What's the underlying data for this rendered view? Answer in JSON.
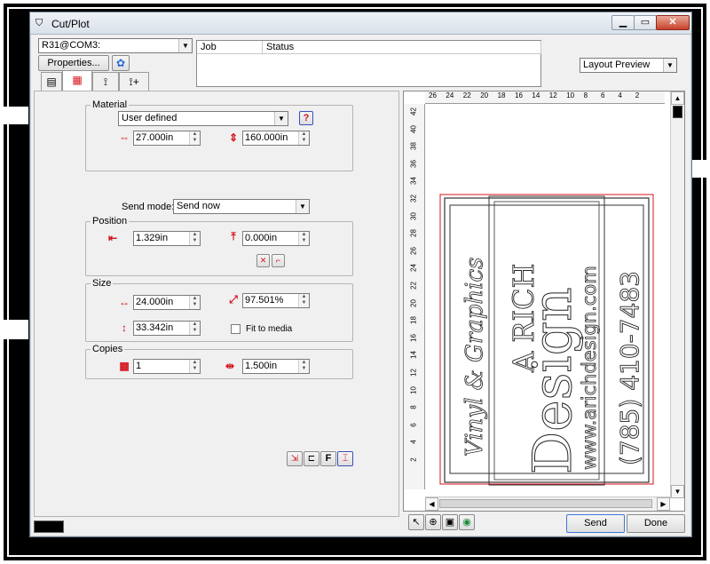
{
  "window": {
    "title": "Cut/Plot"
  },
  "device": {
    "selected": "R31@COM3:"
  },
  "toolbar": {
    "properties_label": "Properties..."
  },
  "job_table": {
    "columns": [
      "Job",
      "Status"
    ]
  },
  "preview_mode": {
    "selected": "Layout Preview"
  },
  "material": {
    "group_label": "Material",
    "type": "User defined",
    "width": "27.000in",
    "height": "160.000in"
  },
  "send_mode": {
    "label": "Send mode:",
    "value": "Send now"
  },
  "position": {
    "group_label": "Position",
    "x": "1.329in",
    "y": "0.000in"
  },
  "size": {
    "group_label": "Size",
    "width": "24.000in",
    "height": "33.342in",
    "scale": "97.501%",
    "fit_to_media_label": "Fit to media",
    "fit_to_media": false
  },
  "copies": {
    "group_label": "Copies",
    "count": "1",
    "spacing": "1.500in"
  },
  "ruler": {
    "h_labels": [
      "26",
      "24",
      "22",
      "20",
      "18",
      "16",
      "14",
      "12",
      "10",
      "8",
      "6",
      "4",
      "2"
    ],
    "v_labels": [
      "42",
      "40",
      "38",
      "36",
      "34",
      "32",
      "30",
      "28",
      "26",
      "24",
      "22",
      "20",
      "18",
      "16",
      "14",
      "12",
      "10",
      "8",
      "6",
      "4",
      "2"
    ]
  },
  "sign": {
    "line1": "A RICH",
    "line2": "Design",
    "left_text": "Vinyl & Graphics",
    "url": "www.arichdesign.com",
    "phone": "(785) 410-7483"
  },
  "actions": {
    "send_label": "Send",
    "done_label": "Done"
  },
  "colors": {
    "accent_red": "#d4141c",
    "window_bg": "#f0f0f0",
    "selection_blue": "#3c78d8"
  }
}
